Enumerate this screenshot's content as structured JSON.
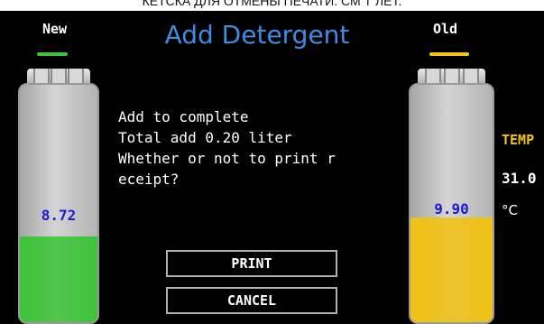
{
  "caption": "КЕТСКА ДЛЯ ОТМЕНЫ ПЕЧАТИ. СМ Т ЛЕТ.",
  "header": {
    "new_label": "New",
    "title": "Add Detergent",
    "old_label": "Old"
  },
  "colors": {
    "title": "#3f8be3",
    "new_accent": "#3fc33a",
    "old_accent": "#f2c414",
    "value_text": "#1a1ad8"
  },
  "tank_new": {
    "value": "8.72",
    "level_fraction": 0.36,
    "color": "#3fc33a"
  },
  "tank_old": {
    "value": "9.90",
    "level_fraction": 0.44,
    "color": "#f0c215"
  },
  "message": {
    "line1": "Add to complete",
    "line2": "Total add 0.20 liter",
    "line3": "Whether or not to print r",
    "line4": "eceipt?"
  },
  "buttons": {
    "print_label": "PRINT",
    "cancel_label": "CANCEL"
  },
  "sidebar": {
    "temp_label": "TEMP",
    "temp_value": "31.0",
    "temp_unit": "°C"
  }
}
